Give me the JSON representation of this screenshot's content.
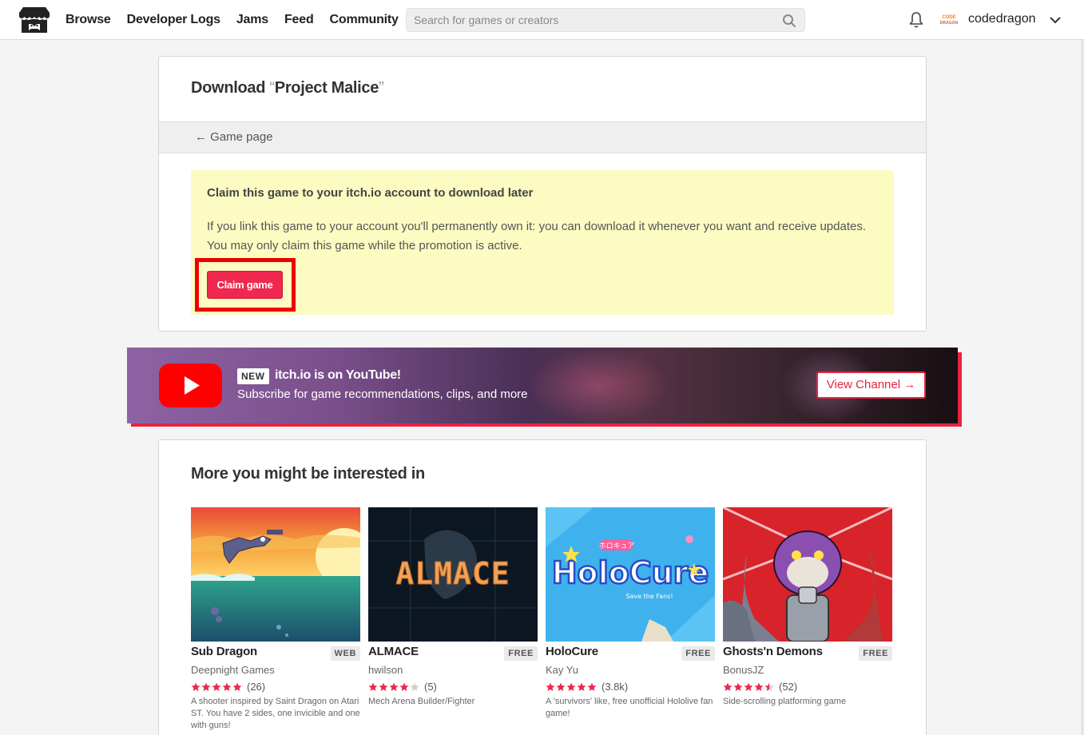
{
  "header": {
    "nav": [
      "Browse",
      "Developer Logs",
      "Jams",
      "Feed",
      "Community"
    ],
    "search_placeholder": "Search for games or creators",
    "avatar_line1": "CODE",
    "avatar_line2": "DRAGON",
    "username": "codedragon"
  },
  "download": {
    "title_prefix": "Download ",
    "open_quote": "“",
    "game_name": "Project Malice",
    "close_quote": "”",
    "back_link": "← Game page",
    "claim_heading": "Claim this game to your itch.io account to download later",
    "claim_text": "If you link this game to your account you'll permanently own it: you can download it whenever you want and receive updates. You may only claim this game while the promotion is active.",
    "claim_button": "Claim game"
  },
  "youtube": {
    "badge": "NEW",
    "title": "itch.io is on YouTube!",
    "subtitle": "Subscribe for game recommendations, clips, and more",
    "button": "View Channel →"
  },
  "recommendations": {
    "title": "More you might be interested in",
    "games": [
      {
        "title": "Sub Dragon",
        "badge": "WEB",
        "author": "Deepnight Games",
        "stars": 5,
        "count": "(26)",
        "desc": "A shooter inspired by Saint Dragon on Atari ST. You have 2 sides, one invicible and one with guns!"
      },
      {
        "title": "ALMACE",
        "badge": "FREE",
        "author": "hwilson",
        "stars": 4,
        "count": "(5)",
        "desc": "Mech Arena Builder/Fighter",
        "thumb_text": "ALMACE"
      },
      {
        "title": "HoloCure",
        "badge": "FREE",
        "author": "Kay Yu",
        "stars": 5,
        "count": "(3.8k)",
        "desc": "A 'survivors' like, free unofficial Hololive fan game!",
        "thumb_text": "HoloCure",
        "thumb_tag": "ホロキュア",
        "thumb_sub": "Save the Fans!"
      },
      {
        "title": "Ghosts'n Demons",
        "badge": "FREE",
        "author": "BonusJZ",
        "stars": 4.5,
        "count": "(52)",
        "desc": "Side-scrolling platforming game"
      }
    ]
  },
  "colors": {
    "accent": "#f0274e",
    "claim_bg": "#fcfbc2",
    "youtube_red": "#e8233f"
  },
  "icons": [
    "itch-logo-icon",
    "search-icon",
    "bell-icon",
    "chevron-down-icon",
    "youtube-play-icon",
    "star-icon"
  ]
}
